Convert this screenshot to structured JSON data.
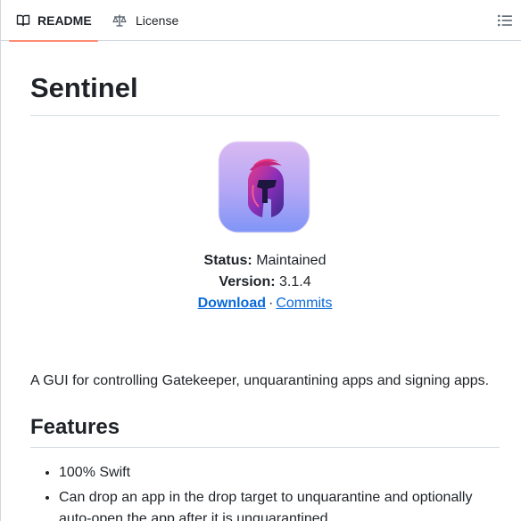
{
  "tabs": {
    "readme": {
      "label": "README",
      "icon": "book-icon",
      "active": true
    },
    "license": {
      "label": "License",
      "icon": "scale-icon"
    },
    "toc_icon": "list-unordered-icon"
  },
  "readme": {
    "title": "Sentinel",
    "status_label": "Status:",
    "status_value": "Maintained",
    "version_label": "Version:",
    "version_value": "3.1.4",
    "download_link": "Download",
    "separator": "·",
    "commits_link": "Commits",
    "description": "A GUI for controlling Gatekeeper, unquarantining apps and signing apps.",
    "features_heading": "Features",
    "features": [
      "100% Swift",
      "Can drop an app in the drop target to unquarantine and optionally auto-open the app after it is unquarantined"
    ]
  },
  "colors": {
    "accent_underline": "#fd8c73",
    "link": "#0969da",
    "text": "#1f2328",
    "border": "#d0d7de"
  }
}
